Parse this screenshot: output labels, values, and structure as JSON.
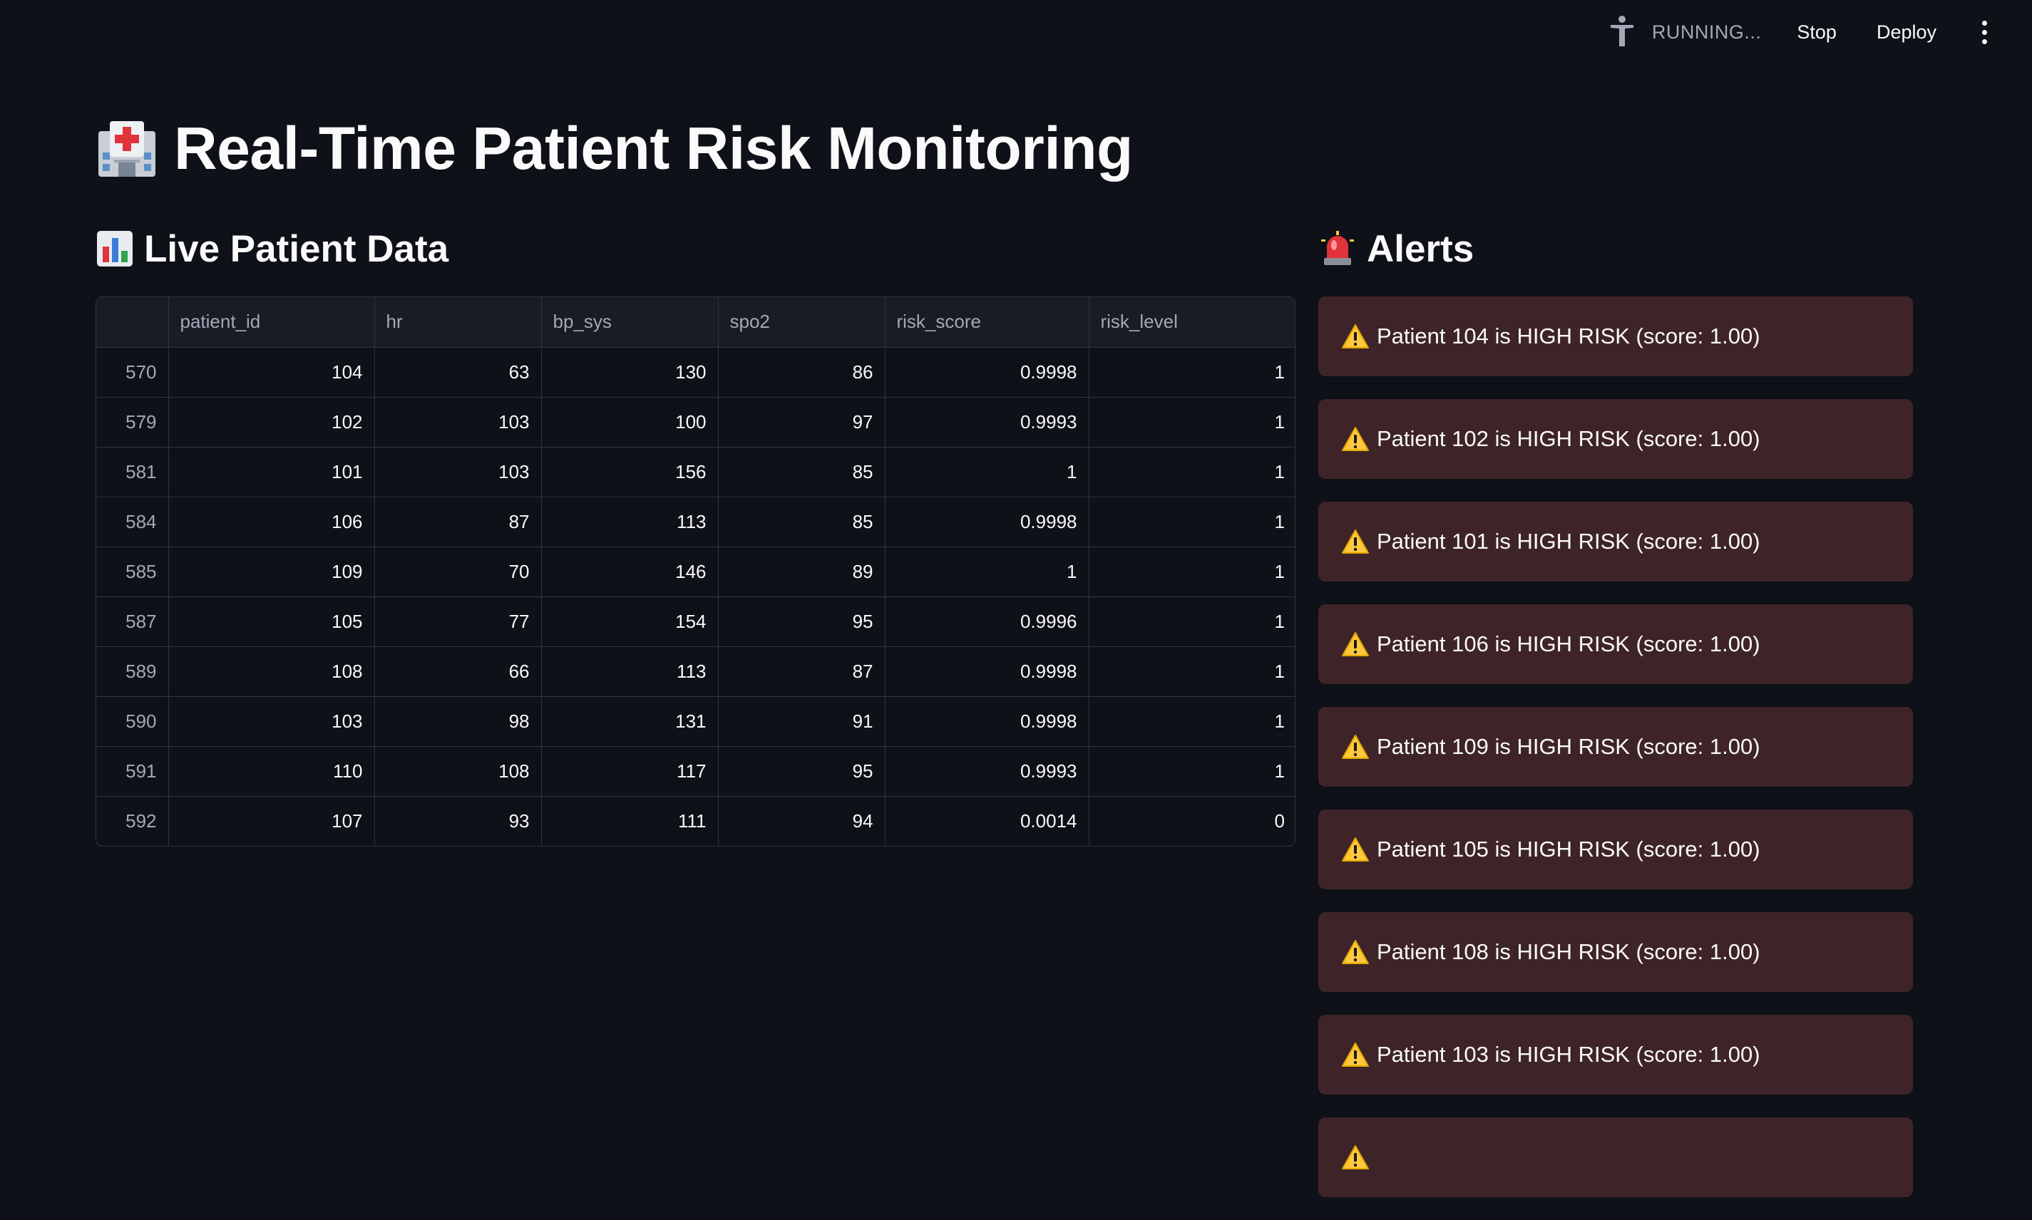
{
  "toolbar": {
    "status": "RUNNING...",
    "stop_label": "Stop",
    "deploy_label": "Deploy"
  },
  "page": {
    "title": "Real-Time Patient Risk Monitoring",
    "title_icon": "hospital-emoji"
  },
  "live_data": {
    "title": "Live Patient Data",
    "title_icon": "bar-chart-emoji",
    "columns": [
      "",
      "patient_id",
      "hr",
      "bp_sys",
      "spo2",
      "risk_score",
      "risk_level"
    ],
    "rows": [
      [
        "570",
        "104",
        "63",
        "130",
        "86",
        "0.9998",
        "1"
      ],
      [
        "579",
        "102",
        "103",
        "100",
        "97",
        "0.9993",
        "1"
      ],
      [
        "581",
        "101",
        "103",
        "156",
        "85",
        "1",
        "1"
      ],
      [
        "584",
        "106",
        "87",
        "113",
        "85",
        "0.9998",
        "1"
      ],
      [
        "585",
        "109",
        "70",
        "146",
        "89",
        "1",
        "1"
      ],
      [
        "587",
        "105",
        "77",
        "154",
        "95",
        "0.9996",
        "1"
      ],
      [
        "589",
        "108",
        "66",
        "113",
        "87",
        "0.9998",
        "1"
      ],
      [
        "590",
        "103",
        "98",
        "131",
        "91",
        "0.9998",
        "1"
      ],
      [
        "591",
        "110",
        "108",
        "117",
        "95",
        "0.9993",
        "1"
      ],
      [
        "592",
        "107",
        "93",
        "111",
        "94",
        "0.0014",
        "0"
      ]
    ]
  },
  "alerts": {
    "title": "Alerts",
    "title_icon": "siren-emoji",
    "items": [
      "Patient 104 is HIGH RISK (score: 1.00)",
      "Patient 102 is HIGH RISK (score: 1.00)",
      "Patient 101 is HIGH RISK (score: 1.00)",
      "Patient 106 is HIGH RISK (score: 1.00)",
      "Patient 109 is HIGH RISK (score: 1.00)",
      "Patient 105 is HIGH RISK (score: 1.00)",
      "Patient 108 is HIGH RISK (score: 1.00)",
      "Patient 103 is HIGH RISK (score: 1.00)",
      ""
    ]
  },
  "colors": {
    "background": "#0e1117",
    "alert_background": "#3e2428",
    "warning_yellow": "#ffc83d",
    "border": "#31333f"
  }
}
